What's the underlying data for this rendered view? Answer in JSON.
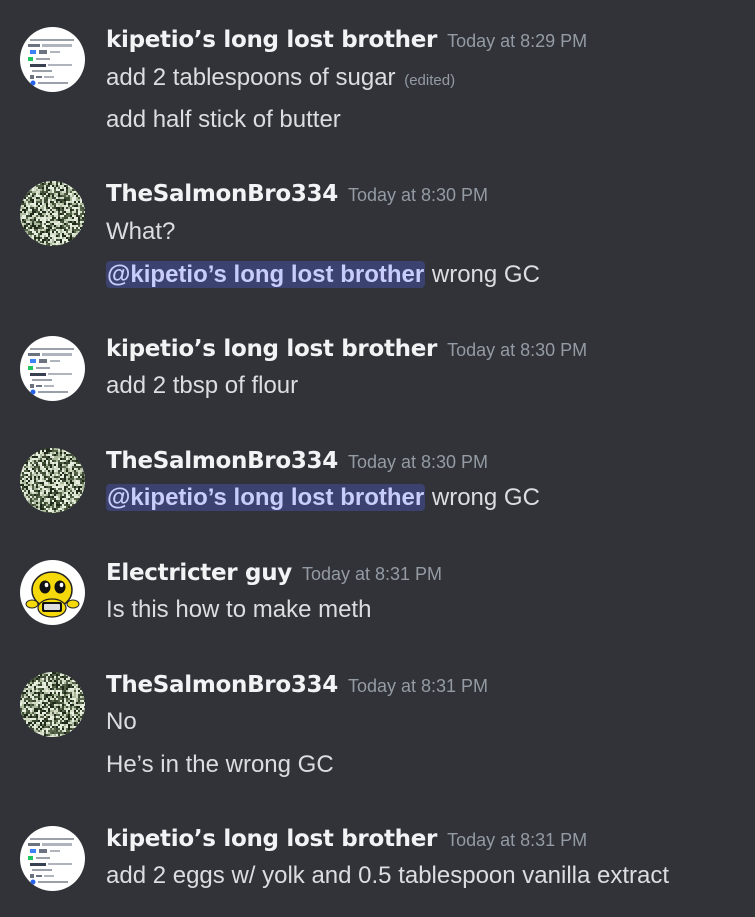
{
  "messages": [
    {
      "username": "kipetio’s long lost brother",
      "timestamp": "Today at 8:29 PM",
      "avatar": "screenshot-avatar",
      "lines": [
        {
          "text": "add 2 tablespoons of sugar",
          "edited": "(edited)"
        },
        {
          "text": "add half stick of butter"
        }
      ]
    },
    {
      "username": "TheSalmonBro334",
      "timestamp": "Today at 8:30 PM",
      "avatar": "noise-avatar",
      "lines": [
        {
          "text": "What?"
        },
        {
          "mention": "@kipetio’s long lost brother",
          "text": " wrong GC"
        }
      ]
    },
    {
      "username": "kipetio’s long lost brother",
      "timestamp": "Today at 8:30 PM",
      "avatar": "screenshot-avatar",
      "lines": [
        {
          "text": "add 2 tbsp of flour"
        }
      ]
    },
    {
      "username": "TheSalmonBro334",
      "timestamp": "Today at 8:30 PM",
      "avatar": "noise-avatar",
      "lines": [
        {
          "mention": "@kipetio’s long lost brother",
          "text": " wrong GC"
        }
      ]
    },
    {
      "username": "Electricter guy",
      "timestamp": "Today at 8:31 PM",
      "avatar": "yellow-creature-avatar",
      "lines": [
        {
          "text": "Is this how to make meth"
        }
      ]
    },
    {
      "username": "TheSalmonBro334",
      "timestamp": "Today at 8:31 PM",
      "avatar": "noise-avatar",
      "lines": [
        {
          "text": "No"
        },
        {
          "text": "He’s in the wrong GC"
        }
      ]
    },
    {
      "username": "kipetio’s long lost brother",
      "timestamp": "Today at 8:31 PM",
      "avatar": "screenshot-avatar",
      "lines": [
        {
          "text": "add 2 eggs w/ yolk and 0.5 tablespoon vanilla extract"
        }
      ]
    }
  ],
  "colors": {
    "background": "#313338",
    "username": "#f2f3f5",
    "timestamp": "#949ba4",
    "message_text": "#dbdee1",
    "mention_bg": "#3c4270",
    "mention_text": "#c9cdfb"
  }
}
